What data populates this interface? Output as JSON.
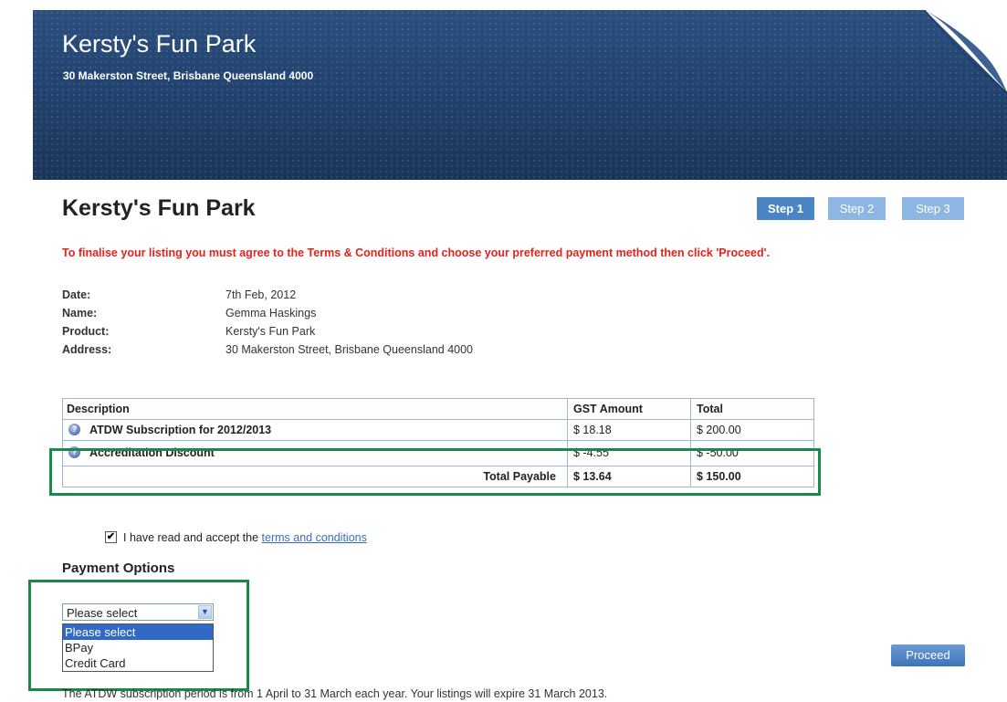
{
  "banner": {
    "title": "Kersty's Fun Park",
    "address": "30 Makerston Street, Brisbane Queensland 4000"
  },
  "page_title": "Kersty's Fun Park",
  "steps": [
    "Step 1",
    "Step 2",
    "Step 3"
  ],
  "active_step": "Step 1",
  "notice": "To finalise your listing you must agree to the Terms & Conditions and choose your preferred payment method then click 'Proceed'.",
  "details": [
    {
      "label": "Date:",
      "value": "7th Feb, 2012"
    },
    {
      "label": "Name:",
      "value": "Gemma Haskings"
    },
    {
      "label": "Product:",
      "value": "Kersty's Fun Park"
    },
    {
      "label": "Address:",
      "value": "30 Makerston Street, Brisbane Queensland 4000"
    }
  ],
  "invoice": {
    "headers": {
      "description": "Description",
      "gst": "GST Amount",
      "total": "Total"
    },
    "rows": [
      {
        "description": "ATDW Subscription for 2012/2013",
        "gst": "$ 18.18",
        "total": "$ 200.00"
      },
      {
        "description": "Accreditation Discount",
        "gst": "$ -4.55",
        "total": "$ -50.00"
      }
    ],
    "total_row": {
      "label": "Total Payable",
      "gst": "$ 13.64",
      "total": "$ 150.00"
    }
  },
  "terms": {
    "checked": true,
    "checkmark": "✔",
    "text": "I have read and accept the",
    "link": "terms and conditions"
  },
  "payment": {
    "title": "Payment Options",
    "selected": "Please select",
    "arrow": "▼",
    "options": [
      "Please select",
      "BPay",
      "Credit Card"
    ]
  },
  "proceed_label": "Proceed",
  "footer_note": "The ATDW subscription period is from 1 April to 31 March each year. Your listings will expire 31 March 2013.",
  "colors": {
    "banner": "#22436f",
    "step_active": "#4a84c4",
    "step_inactive": "#8eb6e2",
    "notice": "#e3231c",
    "highlight": "#1a8a4a",
    "link": "#3a6fb5"
  }
}
